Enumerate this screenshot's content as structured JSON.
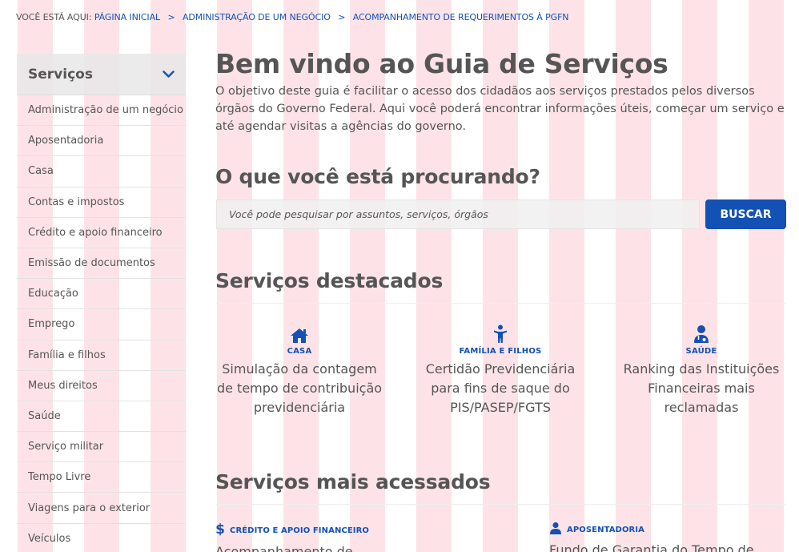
{
  "breadcrumb": {
    "prefix": "VOCÊ ESTÁ AQUI:",
    "items": [
      "PÁGINA INICIAL",
      "ADMINISTRAÇÃO DE UM NEGÓCIO",
      "ACOMPANHAMENTO DE REQUERIMENTOS À PGFN"
    ],
    "separator": ">"
  },
  "sidebar": {
    "title": "Serviços",
    "items": [
      {
        "label": "Administração de um negócio"
      },
      {
        "label": "Aposentadoria"
      },
      {
        "label": "Casa"
      },
      {
        "label": "Contas e impostos"
      },
      {
        "label": "Crédito e apoio financeiro"
      },
      {
        "label": "Emissão de documentos"
      },
      {
        "label": "Educação"
      },
      {
        "label": "Emprego"
      },
      {
        "label": "Família e filhos"
      },
      {
        "label": "Meus direitos"
      },
      {
        "label": "Saúde"
      },
      {
        "label": "Serviço militar"
      },
      {
        "label": "Tempo Livre"
      },
      {
        "label": "Viagens para o exterior"
      },
      {
        "label": "Veículos"
      }
    ]
  },
  "main": {
    "title": "Bem vindo ao Guia de Serviços",
    "intro": "O objetivo deste guia é facilitar o acesso dos cidadãos aos serviços prestados pelos diversos órgãos do Governo Federal. Aqui você poderá encontrar informações úteis, começar um serviço e até agendar visitas a agências do governo.",
    "search": {
      "title": "O que você está procurando?",
      "placeholder": "Você pode pesquisar por assuntos, serviços, órgãos",
      "button_label": "BUSCAR"
    },
    "featured": {
      "title": "Serviços destacados",
      "items": [
        {
          "icon": "home-icon",
          "category": "CASA",
          "description": "Simulação da contagem de tempo de contribuição previdenciária"
        },
        {
          "icon": "child-icon",
          "category": "FAMÍLIA E FILHOS",
          "description": "Certidão Previdenciária para fins de saque do PIS/PASEP/FGTS"
        },
        {
          "icon": "doctor-icon",
          "category": "SAÚDE",
          "description": "Ranking das Instituições Financeiras mais reclamadas"
        }
      ]
    },
    "most_accessed": {
      "title": "Serviços mais acessados",
      "items": [
        {
          "icon": "dollar-icon",
          "category": "CRÉDITO E APOIO FINANCEIRO",
          "description": "Acompanhamento de"
        },
        {
          "icon": "user-icon",
          "category": "APOSENTADORIA",
          "description": "Fundo de Garantia do Tempo de"
        }
      ]
    }
  },
  "colors": {
    "accent": "#1351b4",
    "text": "#555555",
    "stripe": "#fde3e8"
  }
}
